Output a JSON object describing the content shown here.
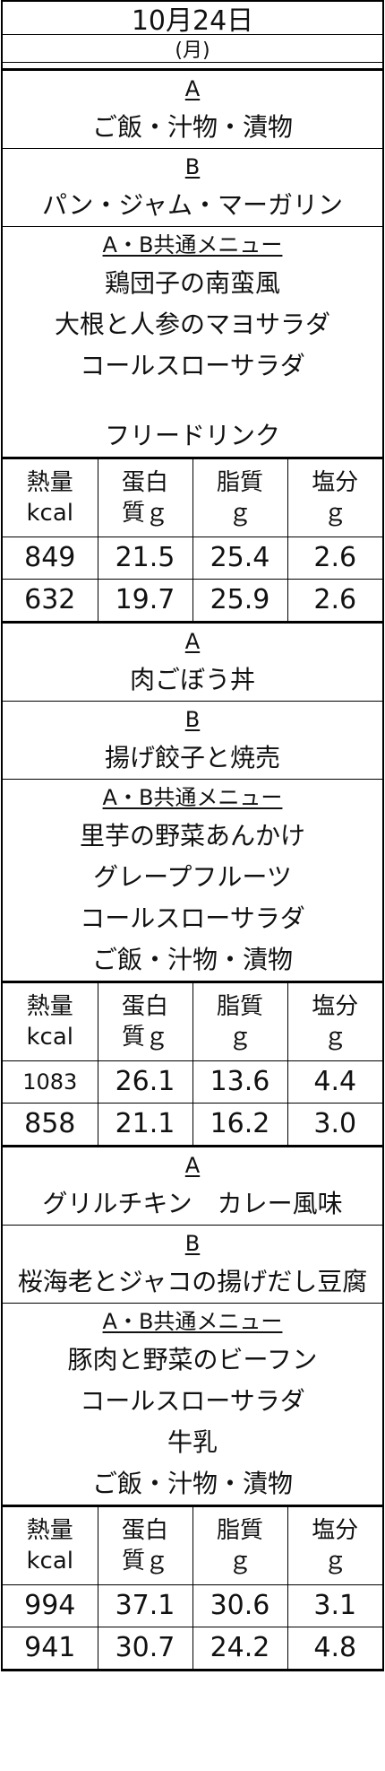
{
  "header": {
    "date": "10月24日",
    "weekday": "(月)"
  },
  "nutrition_headers": [
    "熱量\nkcal",
    "蛋白\n質ｇ",
    "脂質\nｇ",
    "塩分\nｇ"
  ],
  "meals": [
    {
      "a_label": "A",
      "a_menu": [
        "ご飯・汁物・漬物"
      ],
      "b_label": "B",
      "b_menu": [
        "パン・ジャム・マーガリン"
      ],
      "common_label": "A・B共通メニュー",
      "common_menu": [
        "鶏団子の南蛮風",
        "大根と人参のマヨサラダ",
        "コールスローサラダ",
        "",
        "フリードリンク"
      ],
      "nutrition": [
        [
          "849",
          "21.5",
          "25.4",
          "2.6"
        ],
        [
          "632",
          "19.7",
          "25.9",
          "2.6"
        ]
      ]
    },
    {
      "a_label": "A",
      "a_menu": [
        "肉ごぼう丼"
      ],
      "b_label": "B",
      "b_menu": [
        "揚げ餃子と焼売"
      ],
      "common_label": "A・B共通メニュー",
      "common_menu": [
        "里芋の野菜あんかけ",
        "グレープフルーツ",
        "コールスローサラダ",
        "ご飯・汁物・漬物"
      ],
      "nutrition": [
        [
          "1083",
          "26.1",
          "13.6",
          "4.4"
        ],
        [
          "858",
          "21.1",
          "16.2",
          "3.0"
        ]
      ]
    },
    {
      "a_label": "A",
      "a_menu": [
        "グリルチキン　カレー風味"
      ],
      "b_label": "B",
      "b_menu": [
        "桜海老とジャコの揚げだし豆腐"
      ],
      "common_label": "A・B共通メニュー",
      "common_menu": [
        "豚肉と野菜のビーフン",
        "コールスローサラダ",
        "牛乳",
        "ご飯・汁物・漬物"
      ],
      "nutrition": [
        [
          "994",
          "37.1",
          "30.6",
          "3.1"
        ],
        [
          "941",
          "30.7",
          "24.2",
          "4.8"
        ]
      ]
    }
  ]
}
